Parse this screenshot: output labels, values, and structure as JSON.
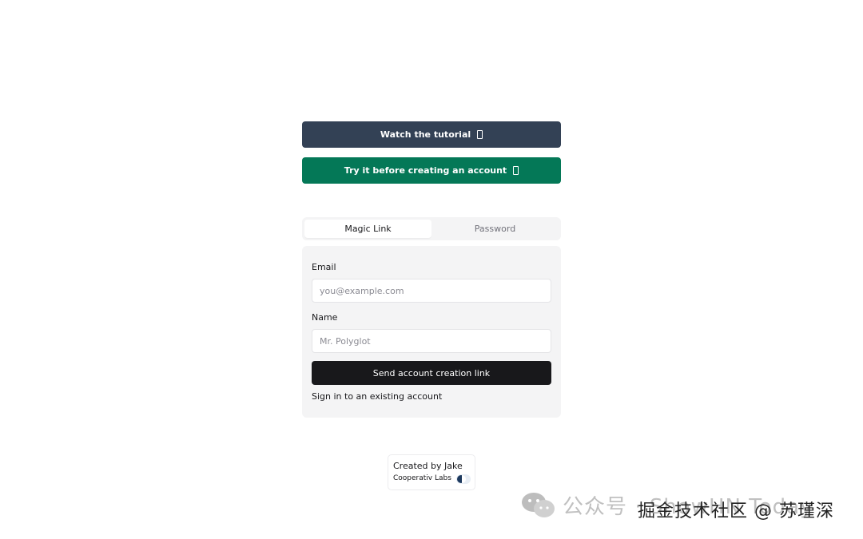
{
  "actions": {
    "tutorial_label": "Watch the tutorial",
    "try_label": "Try it before creating an account",
    "tutorial_color": "#334155",
    "try_color": "#047857"
  },
  "auth": {
    "tabs": [
      {
        "label": "Magic Link",
        "active": true
      },
      {
        "label": "Password",
        "active": false
      }
    ],
    "email_label": "Email",
    "email_placeholder": "you@example.com",
    "name_label": "Name",
    "name_placeholder": "Mr. Polyglot",
    "submit_label": "Send account creation link",
    "signin_link": "Sign in to an existing account"
  },
  "credit": {
    "created_by": "Created by Jake",
    "org": "Cooperativ Labs"
  },
  "watermark": {
    "line1": "公众号 · ShowHN Today",
    "line2": "掘金技术社区 @ 苏瑾深"
  }
}
